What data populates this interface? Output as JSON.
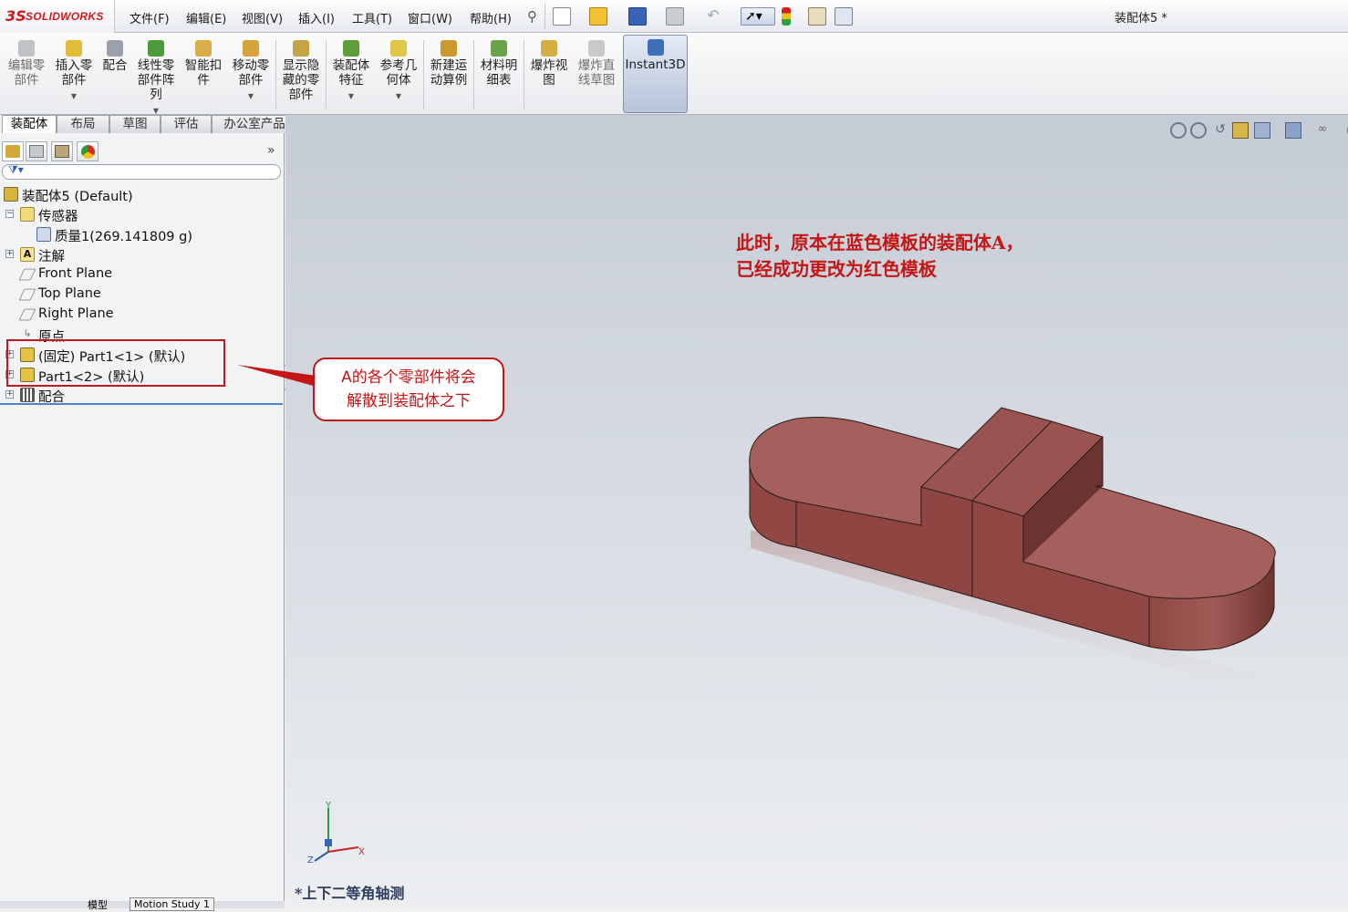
{
  "app": {
    "logo_ds": "3S",
    "logo_text": "SOLIDWORKS"
  },
  "menu": [
    "文件(F)",
    "编辑(E)",
    "视图(V)",
    "插入(I)",
    "工具(T)",
    "窗口(W)",
    "帮助(H)"
  ],
  "document_title": "装配体5 *",
  "command_manager": {
    "buttons": [
      {
        "label": "编辑零\n部件",
        "disabled": true,
        "icon": "edit-component-icon"
      },
      {
        "label": "插入零\n部件",
        "icon": "insert-component-icon"
      },
      {
        "label": "配合",
        "icon": "mate-icon"
      },
      {
        "label": "线性零\n部件阵\n列",
        "icon": "linear-pattern-icon"
      },
      {
        "label": "智能扣\n件",
        "icon": "smart-fastener-icon"
      },
      {
        "label": "移动零\n部件",
        "icon": "move-component-icon"
      },
      {
        "label": "显示隐\n藏的零\n部件",
        "icon": "show-hidden-icon"
      },
      {
        "label": "装配体\n特征",
        "icon": "assembly-feature-icon"
      },
      {
        "label": "参考几\n何体",
        "icon": "reference-geometry-icon"
      },
      {
        "label": "新建运\n动算例",
        "icon": "new-motion-study-icon"
      },
      {
        "label": "材料明\n细表",
        "icon": "bom-icon"
      },
      {
        "label": "爆炸视\n图",
        "icon": "exploded-view-icon"
      },
      {
        "label": "爆炸直\n线草图",
        "disabled": true,
        "icon": "explode-line-sketch-icon"
      },
      {
        "label": "Instant3D",
        "active": true,
        "icon": "instant3d-icon"
      }
    ]
  },
  "tabs": [
    "装配体",
    "布局",
    "草图",
    "评估",
    "办公室产品"
  ],
  "tree": {
    "root": "装配体5  (Default)",
    "items": [
      {
        "label": "传感器",
        "expander": "−"
      },
      {
        "label": "质量1(269.141809 g)"
      },
      {
        "label": "注解",
        "expander": "+"
      },
      {
        "label": "Front Plane"
      },
      {
        "label": "Top Plane"
      },
      {
        "label": "Right Plane"
      },
      {
        "label": "原点"
      },
      {
        "label": "(固定) Part1<1> (默认)",
        "expander": "+"
      },
      {
        "label": "Part1<2> (默认)",
        "expander": "+"
      },
      {
        "label": "配合",
        "expander": "+"
      }
    ]
  },
  "annotation": {
    "line1": "此时，原本在蓝色模板的装配体A，",
    "line2": "已经成功更改为红色模板"
  },
  "callout": {
    "line1": "A的各个零部件将会",
    "line2": "解散到装配体之下"
  },
  "view_label": "*上下二等角轴测",
  "bottom_tabs": [
    "模型",
    "Motion Study 1"
  ],
  "colors": {
    "part_top": "#a65f5c",
    "part_side": "#8e4542",
    "annotation": "#c41616",
    "selection_box": "#c0181f"
  }
}
